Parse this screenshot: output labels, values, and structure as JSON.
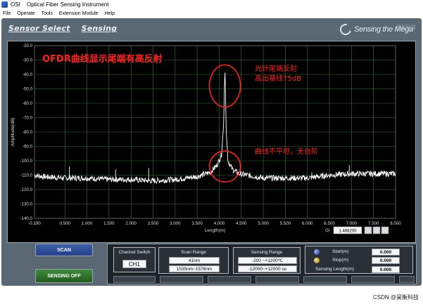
{
  "window": {
    "app_short": "OSI",
    "title": "Optical Fiber Sensing Instrument"
  },
  "menu": [
    "File",
    "Operate",
    "Tools",
    "Extension Module",
    "Help"
  ],
  "tabs": {
    "sensor_select": "Sensor Select",
    "sensing": "Sensing"
  },
  "brand": {
    "text": "Sensing the Mega",
    "watermark": "昊衡科技"
  },
  "annotations": {
    "headline": "OFDR曲线显示尾端有高反射",
    "reflection_line1": "光纤尾端反射",
    "reflection_line2": "高出基线75dB",
    "baseline_note": "曲线不平坦，无台阶"
  },
  "chart_data": {
    "type": "line",
    "xlabel": "Length(m)",
    "ylabel": "Amplitude(dB)",
    "xlim": [
      -0.19,
      8.0
    ],
    "ylim": [
      -140,
      -20
    ],
    "x_ticks": [
      "-0.190",
      "0.500",
      "1.000",
      "1.500",
      "2.000",
      "2.500",
      "3.000",
      "3.500",
      "4.000",
      "4.500",
      "5.000",
      "5.500",
      "6.000",
      "6.500",
      "7.000",
      "7.500",
      "8.000"
    ],
    "y_ticks": [
      "-20.0",
      "-30.0",
      "-40.0",
      "-50.0",
      "-60.0",
      "-70.0",
      "-80.0",
      "-90.0",
      "-100.0",
      "-110.0",
      "-120.0",
      "-130.0",
      "-140.0"
    ],
    "grid": true,
    "series": [
      {
        "color": "#ffffff",
        "x": [
          -0.19,
          0.0,
          0.5,
          0.6,
          1.0,
          1.5,
          2.0,
          2.5,
          3.0,
          3.5,
          3.8,
          3.95,
          4.05,
          4.1,
          4.13,
          4.16,
          4.2,
          4.3,
          4.45,
          5.0,
          5.5,
          6.0,
          6.5,
          7.0,
          7.5,
          8.0
        ],
        "y": [
          -110,
          -111,
          -112,
          -112,
          -112,
          -113,
          -113,
          -114,
          -113,
          -111,
          -108,
          -103,
          -96,
          -75,
          -35,
          -80,
          -100,
          -106,
          -109,
          -112,
          -112,
          -112,
          -110,
          -109,
          -109,
          -109
        ]
      }
    ],
    "spikes_x": [
      0.6,
      1.65,
      2.4,
      6.1,
      6.95
    ],
    "spikes_y": [
      -104,
      -106,
      -105,
      -108,
      -103
    ],
    "gi_label": "GI",
    "gi_value": "1.468200"
  },
  "controls": {
    "scan_button": "SCAN",
    "sensing_button": "SENSING OFF",
    "channel_switch": {
      "label": "Channel Switch",
      "value": "CH1"
    },
    "scan_range": {
      "label": "Scan Range",
      "value1": "41nm",
      "value2": "1535nm~1576nm"
    },
    "sensing_range": {
      "label": "Sensing  Range",
      "value1": "-200 ~+1200℃",
      "value2": "-12000~+12000 us"
    },
    "start": {
      "label": "Start(m)",
      "value": "0.000"
    },
    "stop": {
      "label": "Stop(m)",
      "value": "0.000"
    },
    "sensing_length": {
      "label": "Sensing Length(m)",
      "value": "0.000"
    }
  },
  "footer_watermark": "CSDN @昊衡科技",
  "colors": {
    "panel": "#5a6874",
    "plot_bg": "#000000",
    "grid": "#2e7d2e",
    "trace": "#ffffff",
    "annotation": "#ff2020",
    "scan_button": "#2f4f9a",
    "sensing_button": "#2d6f28"
  }
}
